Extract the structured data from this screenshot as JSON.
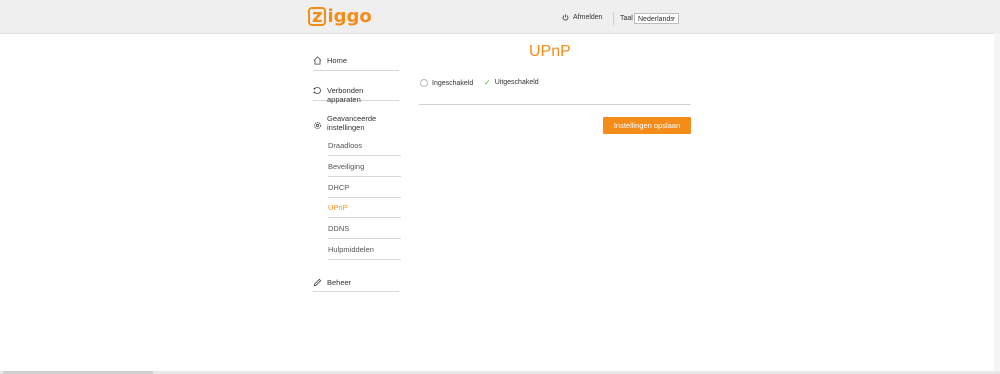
{
  "header": {
    "logo_text": "ziggo",
    "logout_label": "Afmelden",
    "language_label": "Taal",
    "language_selected": "Nederlands"
  },
  "sidebar": {
    "items": [
      {
        "label": "Home",
        "icon": "home-icon"
      },
      {
        "label": "Verbonden apparaten",
        "icon": "devices-icon"
      },
      {
        "label": "Geavanceerde instellingen",
        "icon": "gear-icon"
      },
      {
        "label": "Beheer",
        "icon": "pencil-icon"
      }
    ],
    "sub_items": [
      "Draadloos",
      "Beveiliging",
      "DHCP",
      "UPnP",
      "DDNS",
      "Hulpmiddelen"
    ],
    "active_sub_item": "UPnP"
  },
  "main": {
    "title": "UPnP",
    "options": [
      {
        "label": "Ingeschakeld",
        "selected": false
      },
      {
        "label": "Uitgeschakeld",
        "selected": true
      }
    ],
    "save_label": "Instellingen opslaan"
  },
  "colors": {
    "accent": "#f48c1a",
    "check": "#6ab04c"
  }
}
